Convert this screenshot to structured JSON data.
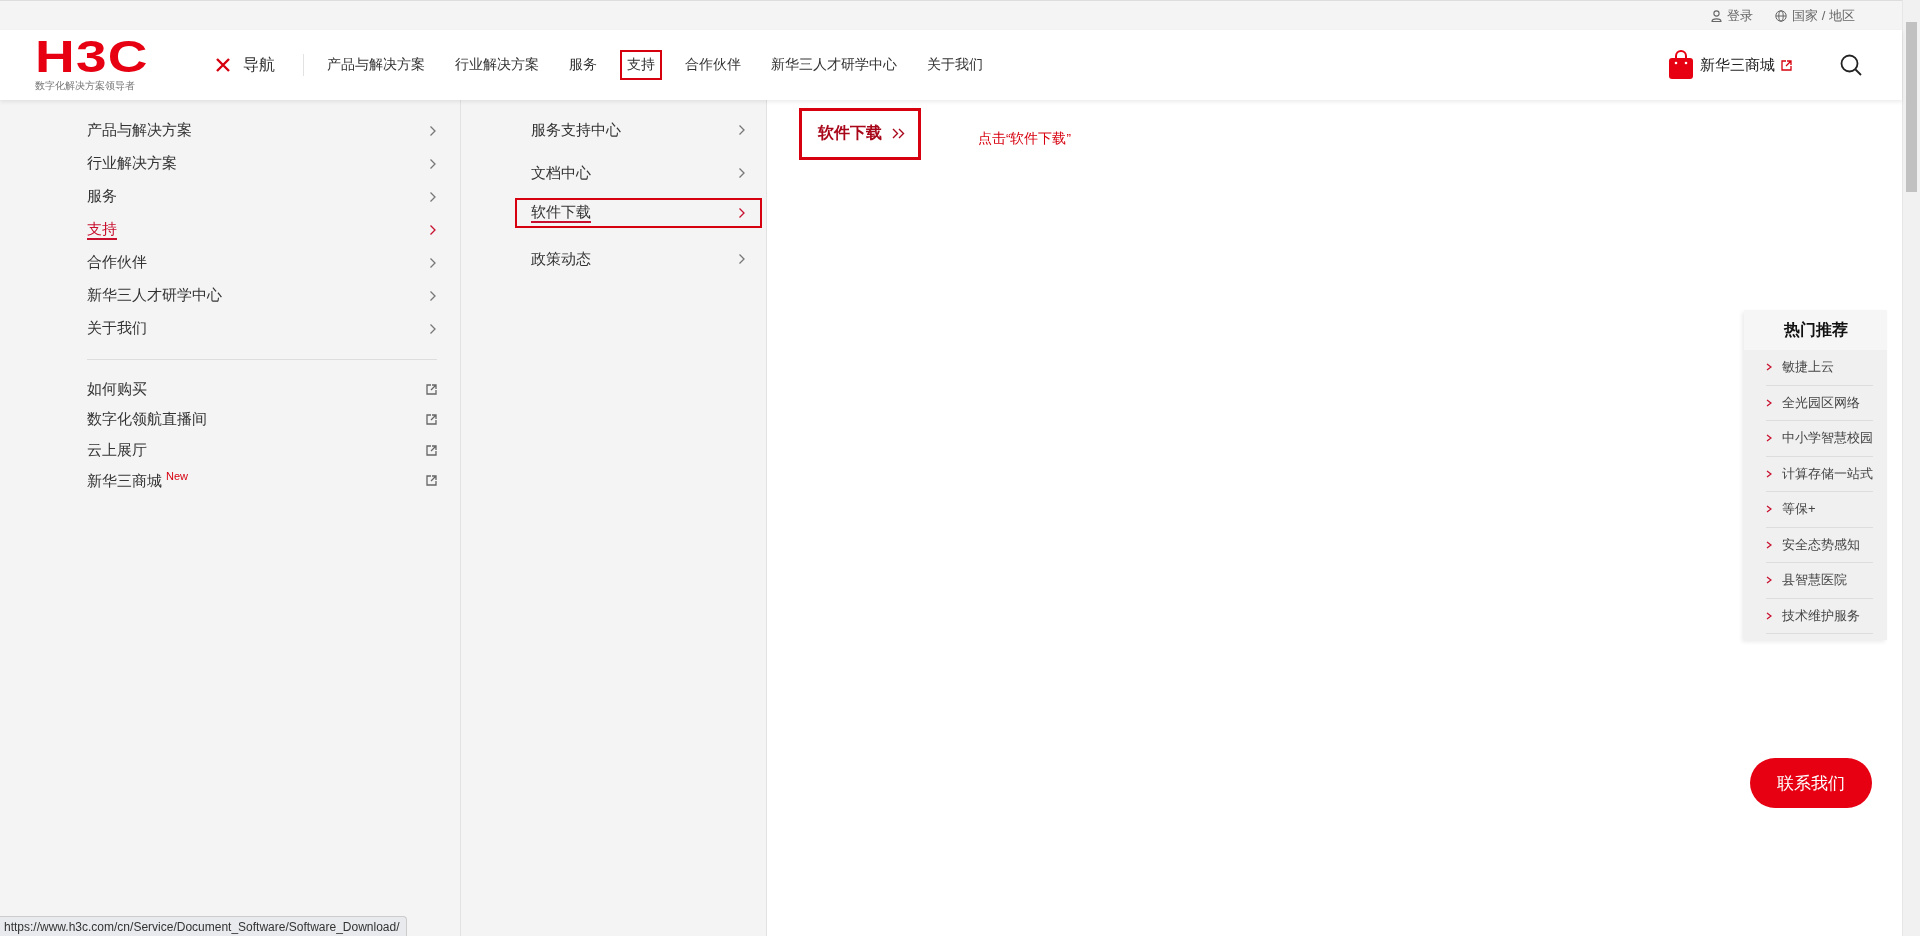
{
  "topbar": {
    "login": "登录",
    "region": "国家 / 地区"
  },
  "header": {
    "logo": {
      "text": "H3C",
      "tagline": "数字化解决方案领导者"
    },
    "nav_toggle": "导航",
    "nav_items": [
      {
        "label": "产品与解决方案",
        "selected": false
      },
      {
        "label": "行业解决方案",
        "selected": false
      },
      {
        "label": "服务",
        "selected": false
      },
      {
        "label": "支持",
        "selected": true
      },
      {
        "label": "合作伙伴",
        "selected": false
      },
      {
        "label": "新华三人才研学中心",
        "selected": false
      },
      {
        "label": "关于我们",
        "selected": false
      }
    ],
    "store": "新华三商城"
  },
  "menu": {
    "items": [
      {
        "label": "产品与解决方案",
        "selected": false
      },
      {
        "label": "行业解决方案",
        "selected": false
      },
      {
        "label": "服务",
        "selected": false
      },
      {
        "label": "支持",
        "selected": true
      },
      {
        "label": "合作伙伴",
        "selected": false
      },
      {
        "label": "新华三人才研学中心",
        "selected": false
      },
      {
        "label": "关于我们",
        "selected": false
      }
    ],
    "links": [
      {
        "label": "如何购买"
      },
      {
        "label": "数字化领航直播间"
      },
      {
        "label": "云上展厅"
      },
      {
        "label": "新华三商城",
        "badge": "New"
      }
    ]
  },
  "submenu": {
    "items": [
      {
        "label": "服务支持中心",
        "selected": false
      },
      {
        "label": "文档中心",
        "selected": false
      },
      {
        "label": "软件下载",
        "selected": true
      },
      {
        "label": "政策动态",
        "selected": false
      }
    ]
  },
  "content": {
    "link": "软件下载",
    "annotation": "点击“软件下载”"
  },
  "hot": {
    "title": "热门推荐",
    "items": [
      {
        "label": "敏捷上云"
      },
      {
        "label": "全光园区网络"
      },
      {
        "label": "中小学智慧校园"
      },
      {
        "label": "计算存储一站式"
      },
      {
        "label": "等保+"
      },
      {
        "label": "安全态势感知"
      },
      {
        "label": "县智慧医院"
      },
      {
        "label": "技术维护服务"
      }
    ]
  },
  "contact_button": "联系我们",
  "status_url": "https://www.h3c.com/cn/Service/Document_Software/Software_Download/"
}
